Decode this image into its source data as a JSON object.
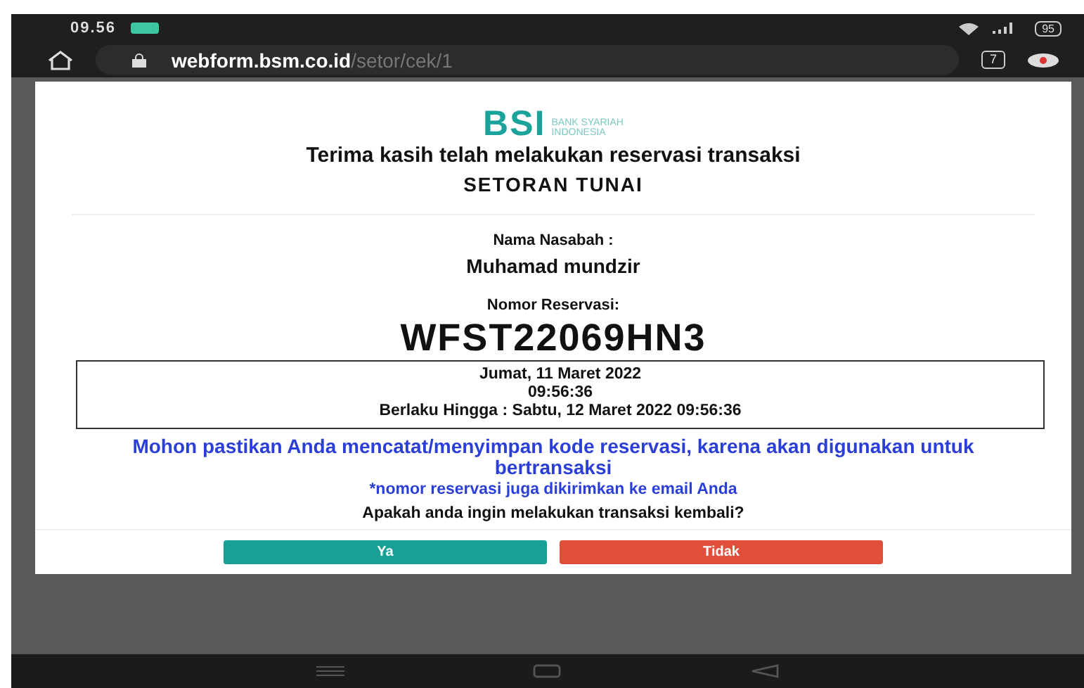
{
  "status_bar": {
    "time": "09.56",
    "battery": "95"
  },
  "browser": {
    "url_host": "webform.bsm.co.id",
    "url_path": "/setor/cek/1",
    "tab_count": "7"
  },
  "logo": {
    "brand": "BSI",
    "tagline_1": "BANK SYARIAH",
    "tagline_2": "INDONESIA"
  },
  "heading": "Terima kasih telah melakukan reservasi transaksi",
  "subheading": "SETORAN TUNAI",
  "customer": {
    "label": "Nama Nasabah :",
    "value": "Muhamad mundzir"
  },
  "reservation": {
    "label": "Nomor Reservasi:",
    "code": "WFST22069HN3"
  },
  "details": [
    "Jumat, 11 Maret 2022",
    "09:56:36",
    "Berlaku Hingga : Sabtu, 12 Maret 2022 09:56:36"
  ],
  "notice": "Mohon pastikan Anda mencatat/menyimpan kode reservasi, karena akan digunakan untuk bertransaksi",
  "note": "*nomor reservasi juga dikirimkan ke email Anda",
  "question": "Apakah anda ingin melakukan transaksi kembali?",
  "buttons": [
    {
      "label": "Ya",
      "kind": "confirm"
    },
    {
      "label": "Tidak",
      "kind": "cancel"
    }
  ]
}
